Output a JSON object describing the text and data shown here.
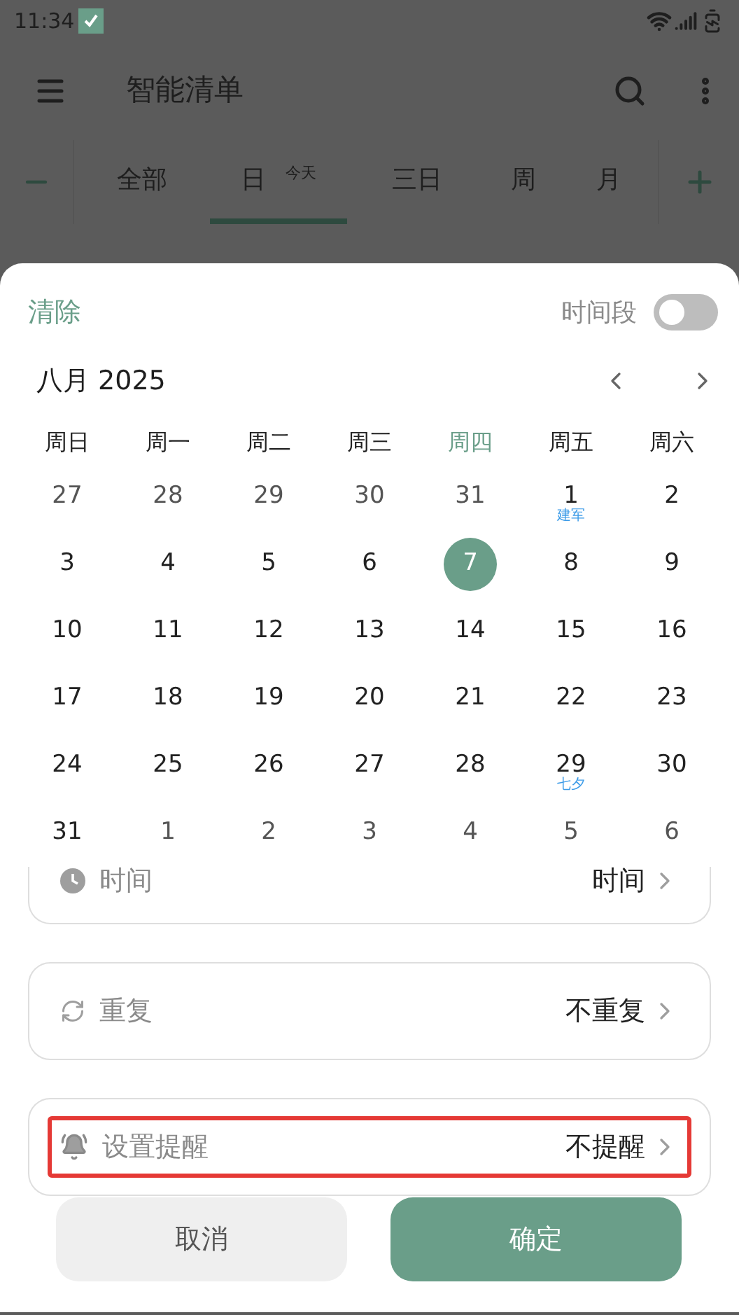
{
  "status_bar": {
    "time": "11:34"
  },
  "app_bar": {
    "title": "智能清单"
  },
  "view_tabs": [
    {
      "label": "全部",
      "selected": false
    },
    {
      "label": "日",
      "badge": "今天",
      "selected": true
    },
    {
      "label": "三日",
      "selected": false
    },
    {
      "label": "周",
      "selected": false
    },
    {
      "label": "月",
      "selected": false
    }
  ],
  "sheet": {
    "clear": "清除",
    "range_label": "时间段",
    "range_on": false,
    "month": "八月 2025",
    "weekdays": [
      {
        "label": "周日",
        "selected": false
      },
      {
        "label": "周一",
        "selected": false
      },
      {
        "label": "周二",
        "selected": false
      },
      {
        "label": "周三",
        "selected": false
      },
      {
        "label": "周四",
        "selected": true
      },
      {
        "label": "周五",
        "selected": false
      },
      {
        "label": "周六",
        "selected": false
      }
    ],
    "weeks": [
      [
        {
          "day": "27",
          "in_month": false,
          "selected": false
        },
        {
          "day": "28",
          "in_month": false,
          "selected": false
        },
        {
          "day": "29",
          "in_month": false,
          "selected": false
        },
        {
          "day": "30",
          "in_month": false,
          "selected": false
        },
        {
          "day": "31",
          "in_month": false,
          "selected": false
        },
        {
          "day": "1",
          "in_month": true,
          "selected": false,
          "note": "建军"
        },
        {
          "day": "2",
          "in_month": true,
          "selected": false
        }
      ],
      [
        {
          "day": "3",
          "in_month": true,
          "selected": false
        },
        {
          "day": "4",
          "in_month": true,
          "selected": false
        },
        {
          "day": "5",
          "in_month": true,
          "selected": false
        },
        {
          "day": "6",
          "in_month": true,
          "selected": false
        },
        {
          "day": "7",
          "in_month": true,
          "selected": true
        },
        {
          "day": "8",
          "in_month": true,
          "selected": false
        },
        {
          "day": "9",
          "in_month": true,
          "selected": false
        }
      ],
      [
        {
          "day": "10",
          "in_month": true,
          "selected": false
        },
        {
          "day": "11",
          "in_month": true,
          "selected": false
        },
        {
          "day": "12",
          "in_month": true,
          "selected": false
        },
        {
          "day": "13",
          "in_month": true,
          "selected": false
        },
        {
          "day": "14",
          "in_month": true,
          "selected": false
        },
        {
          "day": "15",
          "in_month": true,
          "selected": false
        },
        {
          "day": "16",
          "in_month": true,
          "selected": false
        }
      ],
      [
        {
          "day": "17",
          "in_month": true,
          "selected": false
        },
        {
          "day": "18",
          "in_month": true,
          "selected": false
        },
        {
          "day": "19",
          "in_month": true,
          "selected": false
        },
        {
          "day": "20",
          "in_month": true,
          "selected": false
        },
        {
          "day": "21",
          "in_month": true,
          "selected": false
        },
        {
          "day": "22",
          "in_month": true,
          "selected": false
        },
        {
          "day": "23",
          "in_month": true,
          "selected": false
        }
      ],
      [
        {
          "day": "24",
          "in_month": true,
          "selected": false
        },
        {
          "day": "25",
          "in_month": true,
          "selected": false
        },
        {
          "day": "26",
          "in_month": true,
          "selected": false
        },
        {
          "day": "27",
          "in_month": true,
          "selected": false
        },
        {
          "day": "28",
          "in_month": true,
          "selected": false
        },
        {
          "day": "29",
          "in_month": true,
          "selected": false,
          "note": "七夕"
        },
        {
          "day": "30",
          "in_month": true,
          "selected": false
        }
      ],
      [
        {
          "day": "31",
          "in_month": true,
          "selected": false
        },
        {
          "day": "1",
          "in_month": false,
          "selected": false
        },
        {
          "day": "2",
          "in_month": false,
          "selected": false
        },
        {
          "day": "3",
          "in_month": false,
          "selected": false
        },
        {
          "day": "4",
          "in_month": false,
          "selected": false
        },
        {
          "day": "5",
          "in_month": false,
          "selected": false
        },
        {
          "day": "6",
          "in_month": false,
          "selected": false
        }
      ]
    ],
    "options": [
      {
        "kind": "time",
        "label": "时间",
        "value": "时间",
        "highlighted": false
      },
      {
        "kind": "repeat",
        "label": "重复",
        "value": "不重复",
        "highlighted": false
      },
      {
        "kind": "reminder",
        "label": "设置提醒",
        "value": "不提醒",
        "highlighted": true
      }
    ],
    "cancel": "取消",
    "confirm": "确定"
  }
}
